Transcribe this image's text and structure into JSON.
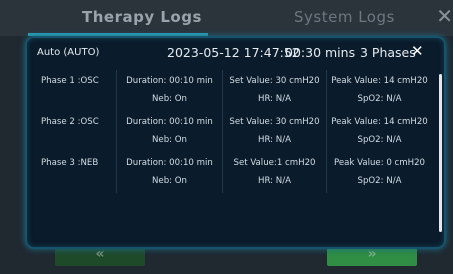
{
  "tabs": {
    "therapy": "Therapy  Logs",
    "system": "System  Logs",
    "close": "✕"
  },
  "dialog": {
    "mode": "Auto (AUTO)",
    "datetime": "2023-05-12 17:47:52",
    "duration": "00:30 mins",
    "phases": "3 Phases",
    "close": "✕"
  },
  "rows": [
    {
      "phase": "Phase  1 :OSC",
      "duration": "Duration: 00:10 min",
      "neb": "Neb: On",
      "set_value": "Set Value: 30 cmH20",
      "hr": "HR: N/A",
      "peak_value": "Peak Value: 14 cmH20",
      "spo2": "SpO2: N/A"
    },
    {
      "phase": "Phase  2 :OSC",
      "duration": "Duration: 00:10 min",
      "neb": "Neb: On",
      "set_value": "Set Value: 30 cmH20",
      "hr": "HR: N/A",
      "peak_value": "Peak Value: 14 cmH20",
      "spo2": "SpO2: N/A"
    },
    {
      "phase": "Phase  3 :NEB",
      "duration": "Duration: 00:10 min",
      "neb": "Neb: On",
      "set_value": "Set Value:1 cmH20",
      "hr": "HR: N/A",
      "peak_value": "Peak Value: 0 cmH20",
      "spo2": "SpO2: N/A"
    }
  ],
  "background_buttons": {
    "left": "«",
    "right": "»"
  },
  "colors": {
    "accent": "#2aa3ba",
    "dialog_bg": "#0a1b2b",
    "confirm_green": "#2f8e43"
  }
}
